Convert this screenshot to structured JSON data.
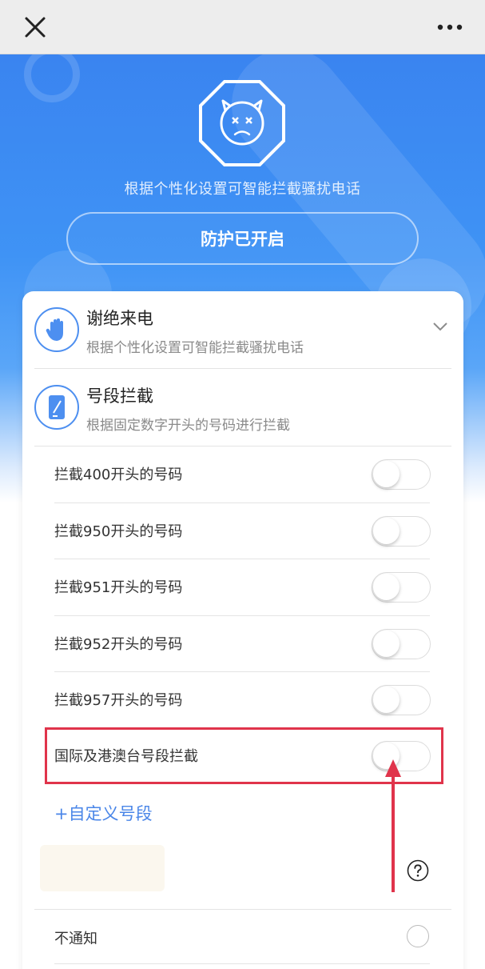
{
  "hero": {
    "subtitle": "根据个性化设置可智能拦截骚扰电话",
    "protect_button": "防护已开启"
  },
  "features": [
    {
      "title": "谢绝来电",
      "desc": "根据个性化设置可智能拦截骚扰电话",
      "icon": "hand-icon"
    },
    {
      "title": "号段拦截",
      "desc": "根据固定数字开头的号码进行拦截",
      "icon": "phone-icon"
    }
  ],
  "toggles": [
    {
      "label": "拦截400开头的号码",
      "on": false
    },
    {
      "label": "拦截950开头的号码",
      "on": false
    },
    {
      "label": "拦截951开头的号码",
      "on": false
    },
    {
      "label": "拦截952开头的号码",
      "on": false
    },
    {
      "label": "拦截957开头的号码",
      "on": false
    },
    {
      "label": "国际及港澳台号段拦截",
      "on": false
    }
  ],
  "add_custom": "+自定义号段",
  "notify": {
    "label": "不通知",
    "selected": false
  },
  "colors": {
    "accent": "#4a86e8",
    "highlight": "#e0344b",
    "hero_blue": "#3a84f0"
  }
}
